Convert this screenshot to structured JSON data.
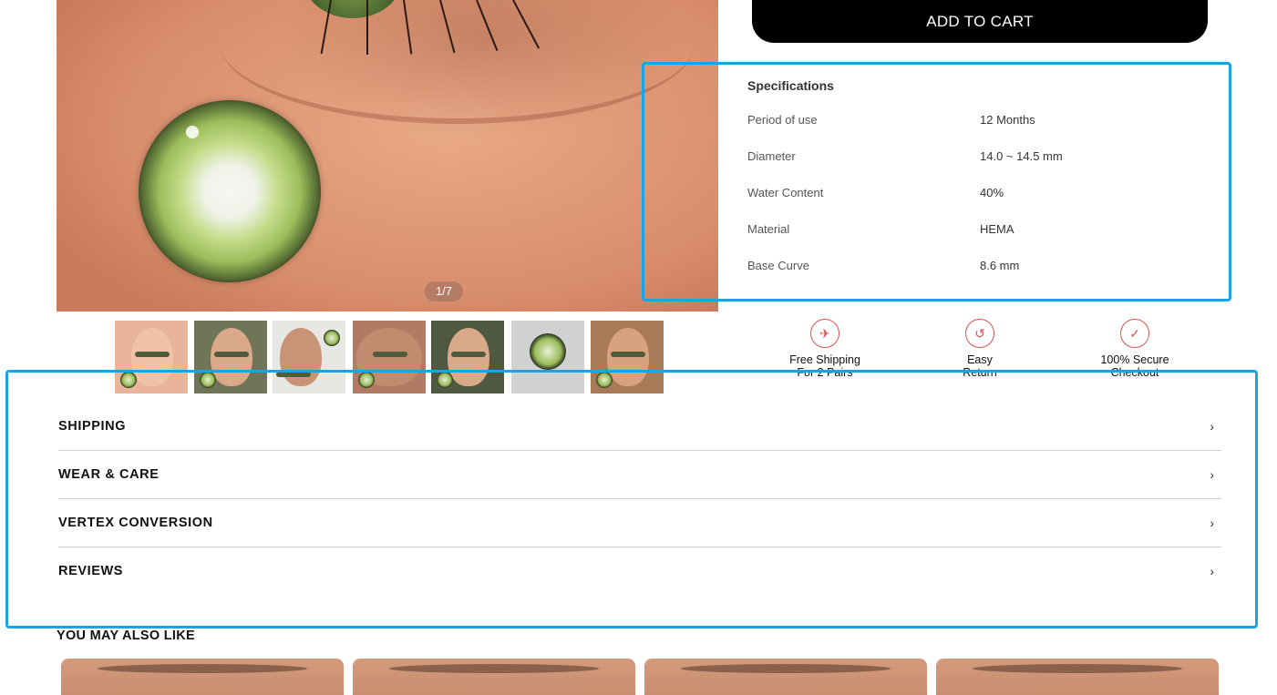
{
  "product": {
    "image_counter": "1/7",
    "add_to_cart_label": "ADD TO CART",
    "thumbnails": [
      "thumb-1",
      "thumb-2",
      "thumb-3",
      "thumb-4",
      "thumb-5",
      "thumb-6",
      "thumb-7"
    ]
  },
  "specifications": {
    "title": "Specifications",
    "rows": [
      {
        "key": "Period of use",
        "value": "12 Months"
      },
      {
        "key": "Diameter",
        "value": "14.0 ~ 14.5 mm"
      },
      {
        "key": "Water Content",
        "value": "40%"
      },
      {
        "key": "Material",
        "value": "HEMA"
      },
      {
        "key": "Base Curve",
        "value": "8.6 mm"
      }
    ]
  },
  "features": [
    {
      "line1": "Free Shipping",
      "line2": "For 2 Pairs",
      "icon": "plane-icon"
    },
    {
      "line1": "Easy",
      "line2": "Return",
      "icon": "return-box-icon"
    },
    {
      "line1": "100% Secure",
      "line2": "Checkout",
      "icon": "shield-check-icon"
    }
  ],
  "accordion": [
    {
      "label": "SHIPPING"
    },
    {
      "label": "WEAR & CARE"
    },
    {
      "label": "VERTEX CONVERSION"
    },
    {
      "label": "REVIEWS"
    }
  ],
  "recommendations": {
    "title": "YOU MAY ALSO LIKE"
  },
  "colors": {
    "highlight": "#1aa3e6",
    "accent": "#d9534f",
    "button": "#000000"
  }
}
